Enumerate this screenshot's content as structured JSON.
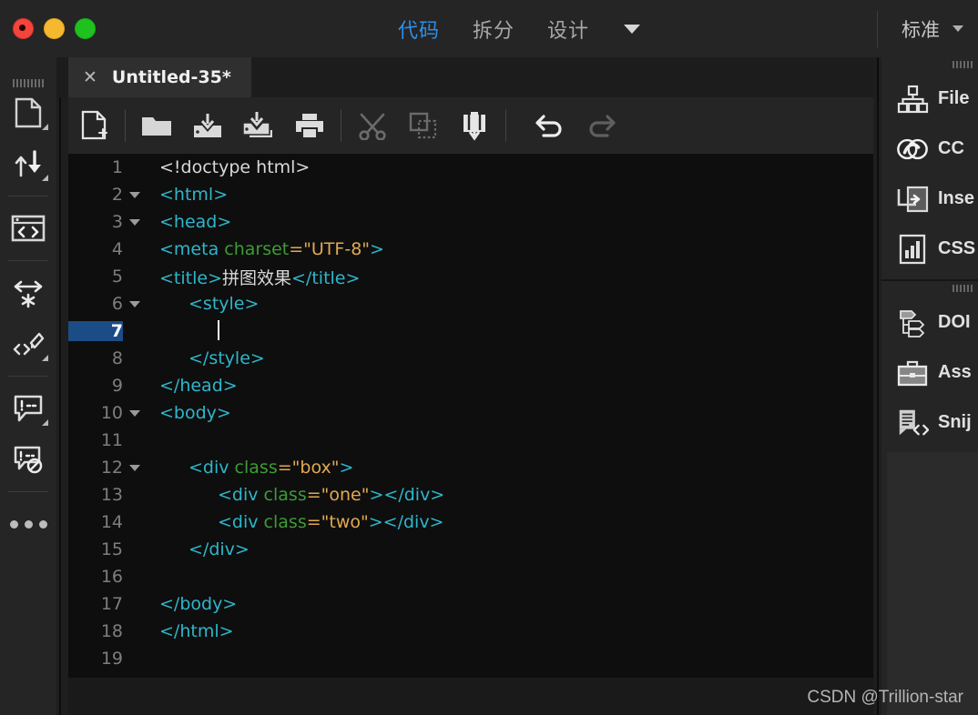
{
  "window": {
    "traffic_lights": [
      "close",
      "minimize",
      "zoom"
    ]
  },
  "titlebar": {
    "view_modes": [
      {
        "label": "代码",
        "active": true
      },
      {
        "label": "拆分",
        "active": false
      },
      {
        "label": "设计",
        "active": false
      }
    ],
    "view_caret_icon": "caret-down-icon",
    "workspace": {
      "label": "标准",
      "caret_icon": "caret-down-icon"
    },
    "accent_active": "#2b8fe8"
  },
  "left_rail": {
    "grip_icon": "grip-handle-icon",
    "items": [
      {
        "icon": "document-page-icon",
        "has_flyout": true
      },
      {
        "icon": "file-transfer-arrows-icon",
        "has_flyout": true
      },
      {
        "icon": "code-view-window-icon",
        "has_flyout": false
      },
      {
        "icon": "format-source-code-icon",
        "has_flyout": false
      },
      {
        "icon": "apply-source-formatting-icon",
        "has_flyout": true
      },
      {
        "icon": "apply-comment-icon",
        "has_flyout": true
      },
      {
        "icon": "remove-comment-icon",
        "has_flyout": false
      },
      {
        "icon": "more-options-icon",
        "has_flyout": false
      }
    ]
  },
  "document_tab": {
    "close_icon": "close-icon",
    "close_glyph": "✕",
    "title": "Untitled-35*"
  },
  "editor_toolbar": {
    "buttons": [
      {
        "icon": "new-document-icon",
        "enabled": true
      },
      {
        "icon": "open-folder-icon",
        "enabled": true
      },
      {
        "icon": "save-icon",
        "enabled": true
      },
      {
        "icon": "save-all-icon",
        "enabled": true
      },
      {
        "icon": "print-code-icon",
        "enabled": true
      },
      {
        "icon": "cut-scissors-icon",
        "enabled": false
      },
      {
        "icon": "copy-icon",
        "enabled": false
      },
      {
        "icon": "paste-icon",
        "enabled": true
      },
      {
        "icon": "undo-icon",
        "enabled": true
      },
      {
        "icon": "redo-icon",
        "enabled": false
      }
    ]
  },
  "code": {
    "current_line": 7,
    "colors": {
      "tag": "#2eb6cb",
      "attribute": "#3e9b36",
      "value": "#e2a950",
      "text": "#d8d8d8",
      "gutter": "#7e7e7e",
      "current_line_bg": "#1c4c86",
      "background": "#0e0e0e"
    },
    "lines": [
      {
        "n": 1,
        "fold": false,
        "indent": 0,
        "tokens": [
          {
            "t": "plain",
            "s": "<!doctype html>"
          }
        ]
      },
      {
        "n": 2,
        "fold": true,
        "indent": 0,
        "tokens": [
          {
            "t": "tag",
            "s": "<html>"
          }
        ]
      },
      {
        "n": 3,
        "fold": true,
        "indent": 0,
        "tokens": [
          {
            "t": "tag",
            "s": "<head>"
          }
        ]
      },
      {
        "n": 4,
        "fold": false,
        "indent": 0,
        "tokens": [
          {
            "t": "tag",
            "s": "<meta "
          },
          {
            "t": "attr",
            "s": "charset"
          },
          {
            "t": "val",
            "s": "=\"UTF-8\""
          },
          {
            "t": "tag",
            "s": ">"
          }
        ]
      },
      {
        "n": 5,
        "fold": false,
        "indent": 0,
        "tokens": [
          {
            "t": "tag",
            "s": "<title>"
          },
          {
            "t": "plain",
            "s": "拼图效果"
          },
          {
            "t": "tag",
            "s": "</title>"
          }
        ]
      },
      {
        "n": 6,
        "fold": true,
        "indent": 1,
        "tokens": [
          {
            "t": "tag",
            "s": "<style>"
          }
        ]
      },
      {
        "n": 7,
        "fold": false,
        "indent": 2,
        "tokens": [
          {
            "t": "cursor",
            "s": ""
          }
        ]
      },
      {
        "n": 8,
        "fold": false,
        "indent": 1,
        "tokens": [
          {
            "t": "tag",
            "s": "</style>"
          }
        ]
      },
      {
        "n": 9,
        "fold": false,
        "indent": 0,
        "tokens": [
          {
            "t": "tag",
            "s": "</head>"
          }
        ]
      },
      {
        "n": 10,
        "fold": true,
        "indent": 0,
        "tokens": [
          {
            "t": "tag",
            "s": "<body>"
          }
        ]
      },
      {
        "n": 11,
        "fold": false,
        "indent": 0,
        "tokens": []
      },
      {
        "n": 12,
        "fold": true,
        "indent": 1,
        "tokens": [
          {
            "t": "tag",
            "s": "<div "
          },
          {
            "t": "attr",
            "s": "class"
          },
          {
            "t": "val",
            "s": "=\"box\""
          },
          {
            "t": "tag",
            "s": ">"
          }
        ]
      },
      {
        "n": 13,
        "fold": false,
        "indent": 2,
        "tokens": [
          {
            "t": "tag",
            "s": "<div "
          },
          {
            "t": "attr",
            "s": "class"
          },
          {
            "t": "val",
            "s": "=\"one\""
          },
          {
            "t": "tag",
            "s": "></div>"
          }
        ]
      },
      {
        "n": 14,
        "fold": false,
        "indent": 2,
        "tokens": [
          {
            "t": "tag",
            "s": "<div "
          },
          {
            "t": "attr",
            "s": "class"
          },
          {
            "t": "val",
            "s": "=\"two\""
          },
          {
            "t": "tag",
            "s": "></div>"
          }
        ]
      },
      {
        "n": 15,
        "fold": false,
        "indent": 1,
        "tokens": [
          {
            "t": "tag",
            "s": "</div>"
          }
        ]
      },
      {
        "n": 16,
        "fold": false,
        "indent": 0,
        "tokens": []
      },
      {
        "n": 17,
        "fold": false,
        "indent": 0,
        "tokens": [
          {
            "t": "tag",
            "s": "</body>"
          }
        ]
      },
      {
        "n": 18,
        "fold": false,
        "indent": 0,
        "tokens": [
          {
            "t": "tag",
            "s": "</html>"
          }
        ]
      },
      {
        "n": 19,
        "fold": false,
        "indent": 0,
        "tokens": []
      }
    ]
  },
  "right_panel": {
    "groups": [
      {
        "grip_icon": "grip-handle-icon",
        "items": [
          {
            "icon": "files-tree-icon",
            "label": "File"
          },
          {
            "icon": "creative-cloud-icon",
            "label": "CC"
          },
          {
            "icon": "insert-panel-icon",
            "label": "Inse"
          },
          {
            "icon": "css-designer-icon",
            "label": "CSS"
          }
        ]
      },
      {
        "grip_icon": "grip-handle-icon",
        "items": [
          {
            "icon": "dom-tree-icon",
            "label": "DOI"
          },
          {
            "icon": "assets-briefcase-icon",
            "label": "Ass"
          },
          {
            "icon": "snippets-icon",
            "label": "Snij"
          }
        ]
      }
    ]
  },
  "watermark": {
    "text": "CSDN @Trillion-star"
  }
}
